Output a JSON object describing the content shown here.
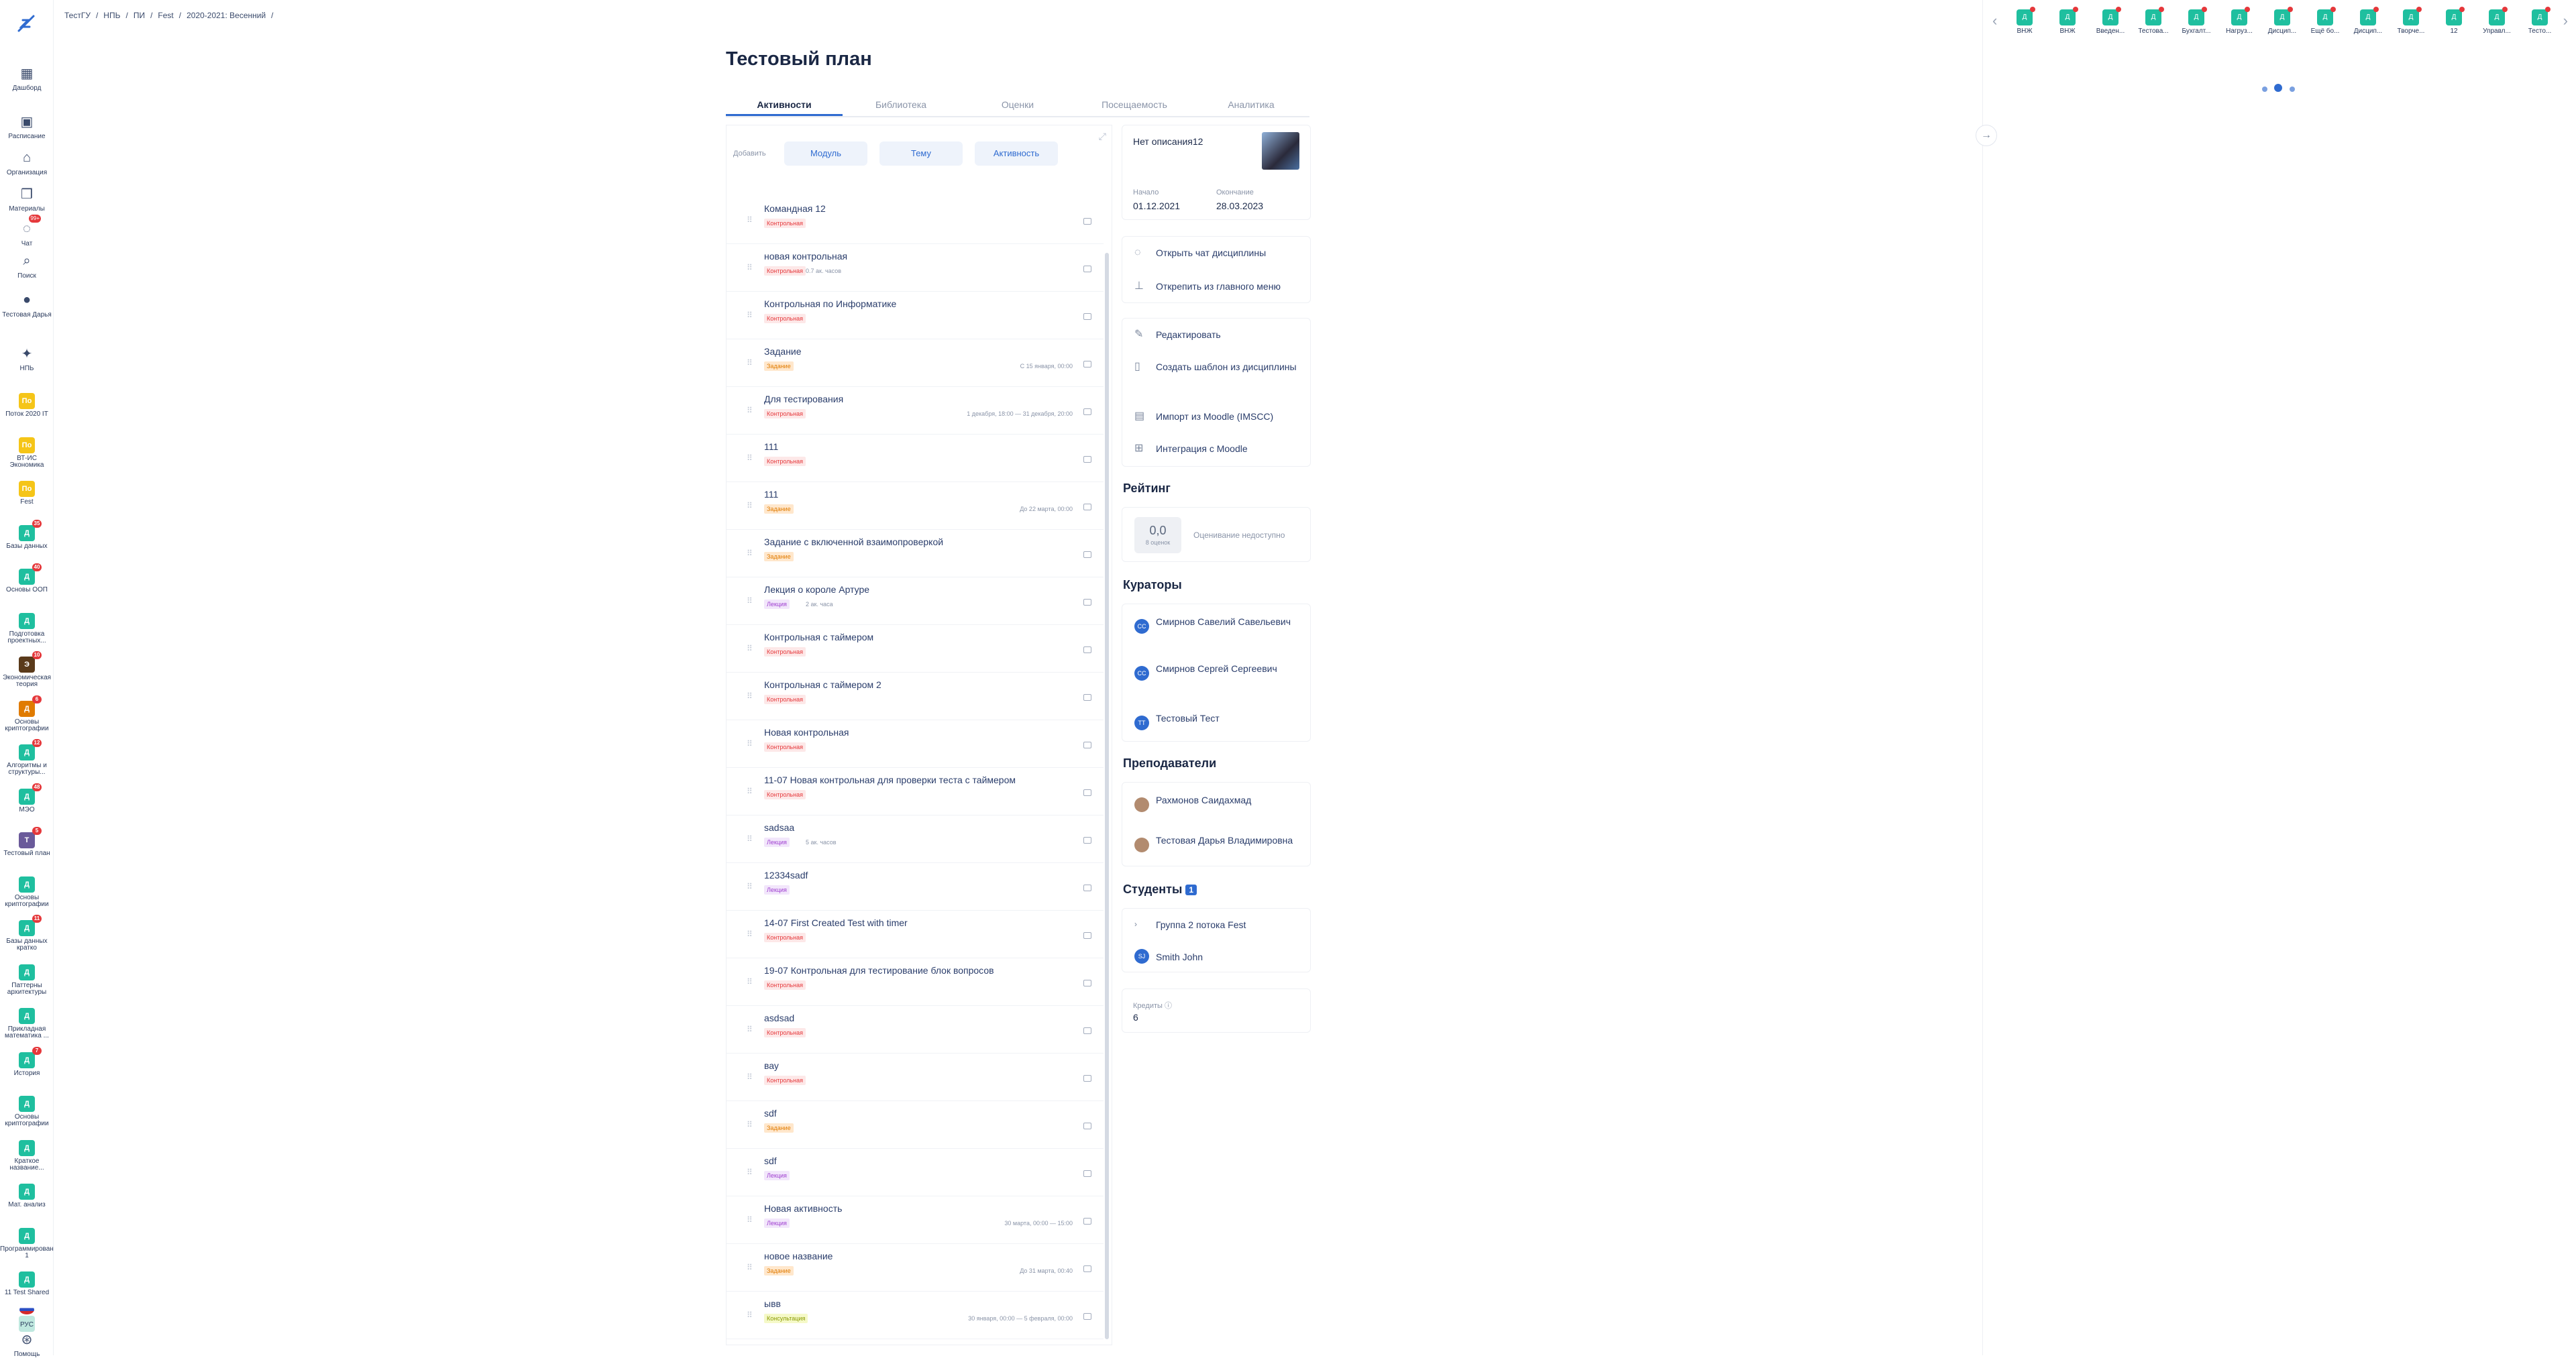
{
  "breadcrumbs": [
    "ТестГУ",
    "/",
    "НПЬ",
    "/",
    "ПИ",
    "/",
    "Fest",
    "/",
    "2020-2021: Весенний",
    "/"
  ],
  "sidebar": {
    "nav": [
      {
        "label": "Дашборд",
        "icon": "dashboard-icon",
        "glyph": "▦"
      },
      {
        "label": "Расписание",
        "icon": "calendar-icon",
        "glyph": "▣"
      },
      {
        "label": "Организация",
        "icon": "building-icon",
        "glyph": "⌂"
      },
      {
        "label": "Материалы",
        "icon": "book-icon",
        "glyph": "❒"
      },
      {
        "label": "Чат",
        "icon": "chat-icon",
        "glyph": "◌",
        "badge": "99+"
      },
      {
        "label": "Поиск",
        "icon": "search-icon",
        "glyph": "⌕"
      },
      {
        "label": "Тестовая Дарья",
        "icon": "avatar-icon",
        "glyph": "●"
      },
      {
        "label": "НПЬ",
        "icon": "org-icon",
        "glyph": "✦"
      }
    ],
    "courses": [
      {
        "label": "Поток 2020 IT",
        "ch": "Пo",
        "color": "#f5c518"
      },
      {
        "label": "ВТ-ИС Экономика",
        "ch": "Пo",
        "color": "#f5c518"
      },
      {
        "label": "Fest",
        "ch": "Пo",
        "color": "#f5c518"
      },
      {
        "label": "Базы данных",
        "ch": "Д",
        "color": "#1fbf9f",
        "badge": "35"
      },
      {
        "label": "Основы ООП",
        "ch": "Д",
        "color": "#1fbf9f",
        "badge": "40"
      },
      {
        "label": "Подготовка проектных...",
        "ch": "Д",
        "color": "#1fbf9f"
      },
      {
        "label": "Экономическая теория",
        "ch": "Э",
        "color": "#5a3a1a",
        "badge": "10"
      },
      {
        "label": "Основы криптографии",
        "ch": "Д",
        "color": "#e07b00",
        "badge": "6"
      },
      {
        "label": "Алгоритмы и структуры...",
        "ch": "Д",
        "color": "#1fbf9f",
        "badge": "12"
      },
      {
        "label": "МЭО",
        "ch": "Д",
        "color": "#1fbf9f",
        "badge": "48"
      },
      {
        "label": "Тестовый план",
        "ch": "Т",
        "color": "#6a5a9a",
        "badge": "5"
      },
      {
        "label": "Основы криптографии",
        "ch": "Д",
        "color": "#1fbf9f"
      },
      {
        "label": "Базы данных кратко",
        "ch": "Д",
        "color": "#1fbf9f",
        "badge": "11"
      },
      {
        "label": "Паттерны архитектуры",
        "ch": "Д",
        "color": "#1fbf9f"
      },
      {
        "label": "Прикладная математика ...",
        "ch": "Д",
        "color": "#1fbf9f"
      },
      {
        "label": "История",
        "ch": "Д",
        "color": "#1fbf9f",
        "badge": "7"
      },
      {
        "label": "Основы криптографии",
        "ch": "Д",
        "color": "#1fbf9f"
      },
      {
        "label": "Краткое название...",
        "ch": "Д",
        "color": "#1fbf9f"
      },
      {
        "label": "Мат. анализ",
        "ch": "Д",
        "color": "#1fbf9f"
      },
      {
        "label": "Программирование 1",
        "ch": "Д",
        "color": "#1fbf9f"
      },
      {
        "label": "11 Test Shared",
        "ch": "Д",
        "color": "#1fbf9f"
      },
      {
        "label": "",
        "ch": "",
        "color": "#bfe8df"
      }
    ],
    "lang": "РУС",
    "help": "Помощь"
  },
  "page": {
    "title": "Тестовый план"
  },
  "tabs": [
    {
      "label": "Активности",
      "active": true
    },
    {
      "label": "Библиотека"
    },
    {
      "label": "Оценки"
    },
    {
      "label": "Посещаемость"
    },
    {
      "label": "Аналитика"
    }
  ],
  "add": {
    "label": "Добавить",
    "module": "Модуль",
    "topic": "Тему",
    "activity": "Активность"
  },
  "activities": [
    {
      "title": "Командная 12",
      "tag": "Контрольная",
      "type": "k"
    },
    {
      "title": "новая контрольная",
      "tag": "Контрольная",
      "type": "k",
      "meta": "0.7 ак. часов"
    },
    {
      "title": "Контрольная по Информатике",
      "tag": "Контрольная",
      "type": "k"
    },
    {
      "title": "Задание",
      "tag": "Задание",
      "type": "z",
      "date": "С 15 января, 00:00"
    },
    {
      "title": "Для тестирования",
      "tag": "Контрольная",
      "type": "k",
      "date": "1 декабря, 18:00 — 31 декабря, 20:00"
    },
    {
      "title": "111",
      "tag": "Контрольная",
      "type": "k"
    },
    {
      "title": "111",
      "tag": "Задание",
      "type": "z",
      "date": "До 22 марта, 00:00"
    },
    {
      "title": "Задание с включенной взаимопроверкой",
      "tag": "Задание",
      "type": "z"
    },
    {
      "title": "Лекция о короле Артуре",
      "tag": "Лекция",
      "type": "l",
      "meta": "2 ак. часа"
    },
    {
      "title": "Контрольная с таймером",
      "tag": "Контрольная",
      "type": "k"
    },
    {
      "title": "Контрольная с таймером 2",
      "tag": "Контрольная",
      "type": "k"
    },
    {
      "title": "Новая контрольная",
      "tag": "Контрольная",
      "type": "k"
    },
    {
      "title": "11-07 Новая контрольная для проверки теста с таймером",
      "tag": "Контрольная",
      "type": "k"
    },
    {
      "title": "sadsaa",
      "tag": "Лекция",
      "type": "l",
      "meta": "5 ак. часов"
    },
    {
      "title": "12334sadf",
      "tag": "Лекция",
      "type": "l"
    },
    {
      "title": "14-07 First Created Test with timer",
      "tag": "Контрольная",
      "type": "k"
    },
    {
      "title": "19-07 Контрольная для тестирование блок вопросов",
      "tag": "Контрольная",
      "type": "k"
    },
    {
      "title": "asdsad",
      "tag": "Контрольная",
      "type": "k"
    },
    {
      "title": "вау",
      "tag": "Контрольная",
      "type": "k"
    },
    {
      "title": "sdf",
      "tag": "Задание",
      "type": "z"
    },
    {
      "title": "sdf",
      "tag": "Лекция",
      "type": "l"
    },
    {
      "title": "Новая активность",
      "tag": "Лекция",
      "type": "l",
      "date": "30 марта, 00:00 — 15:00"
    },
    {
      "title": "новое название",
      "tag": "Задание",
      "type": "z",
      "date": "До 31 марта, 00:40"
    },
    {
      "title": "ывв",
      "tag": "Консультация",
      "type": "c",
      "date": "30 января, 00:00 — 5 февраля, 00:00"
    }
  ],
  "info": {
    "desc": "Нет описания12",
    "start_label": "Начало",
    "start": "01.12.2021",
    "end_label": "Окончание",
    "end": "28.03.2023"
  },
  "actions1": [
    {
      "label": "Открыть чат дисциплины",
      "icon": "chat-icon",
      "glyph": "◌"
    },
    {
      "label": "Открепить из главного меню",
      "icon": "pin-icon",
      "glyph": "⊥"
    }
  ],
  "actions2": [
    {
      "label": "Редактировать",
      "icon": "edit-icon",
      "glyph": "✎"
    },
    {
      "label": "Создать шаблон из дисциплины",
      "icon": "file-icon",
      "glyph": "▯"
    },
    {
      "label": "Импорт из Moodle (IMSCC)",
      "icon": "import-icon",
      "glyph": "▤"
    },
    {
      "label": "Интеграция с Moodle",
      "icon": "grid-icon",
      "glyph": "⊞"
    }
  ],
  "rating": {
    "title": "Рейтинг",
    "value": "0,0",
    "sub": "8 оценок",
    "note": "Оценивание недоступно"
  },
  "curators": {
    "title": "Кураторы",
    "items": [
      {
        "name": "Смирнов Савелий Савельевич",
        "init": "СС"
      },
      {
        "name": "Смирнов Сергей Сергеевич",
        "init": "СС"
      },
      {
        "name": "Тестовый Тест",
        "init": "ТТ"
      }
    ]
  },
  "teachers": {
    "title": "Преподаватели",
    "items": [
      {
        "name": "Рахмонов Саидахмад"
      },
      {
        "name": "Тестовая Дарья Владимировна"
      }
    ]
  },
  "students": {
    "title": "Студенты",
    "count": "1",
    "group": "Группа 2 потока Fest",
    "student": "Smith John",
    "init": "SJ"
  },
  "credits": {
    "label": "Кредиты",
    "value": "6"
  },
  "topbar": [
    "ВНЖ",
    "ВНЖ",
    "Введен...",
    "Тестова...",
    "Бухгалт...",
    "Нагруз...",
    "Дисцип...",
    "Ещё бо...",
    "Дисцип...",
    "Творче...",
    "12",
    "Управл...",
    "Тесто..."
  ],
  "colors": {
    "accent": "#2f6bd0",
    "danger": "#e5383b",
    "course": "#1fbf9f"
  }
}
